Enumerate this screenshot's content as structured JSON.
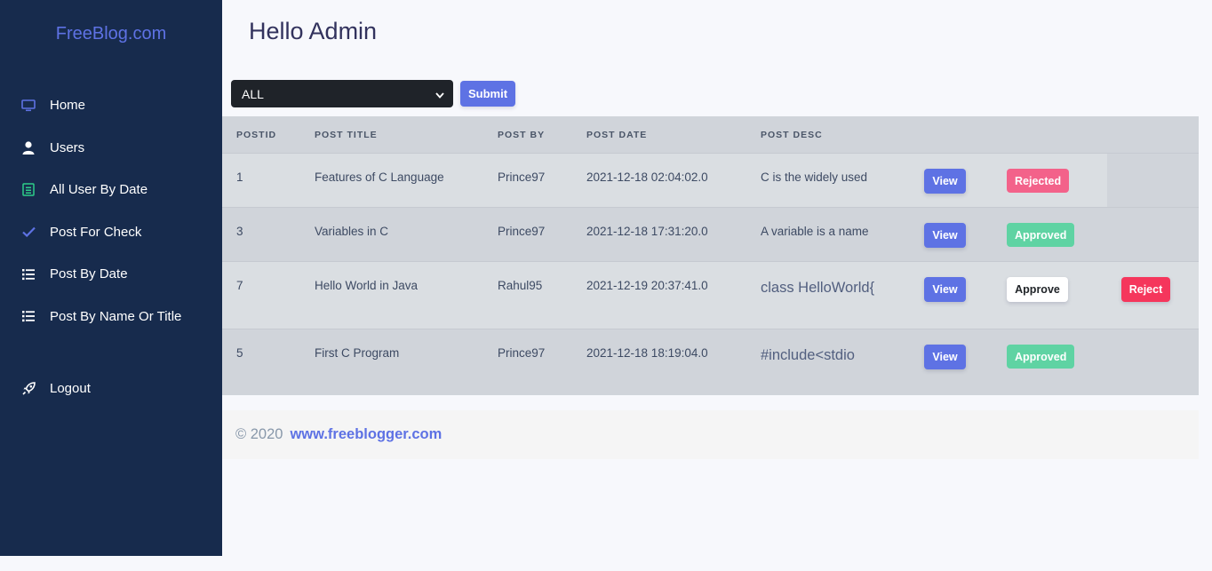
{
  "sidebar": {
    "brand": "FreeBlog.com",
    "items": [
      {
        "label": "Home",
        "icon": "monitor-icon"
      },
      {
        "label": "Users",
        "icon": "user-icon"
      },
      {
        "label": "All User By Date",
        "icon": "calendar-list-icon"
      },
      {
        "label": "Post For Check",
        "icon": "check-icon"
      },
      {
        "label": "Post By Date",
        "icon": "list-icon"
      },
      {
        "label": "Post By Name Or Title",
        "icon": "list-icon"
      }
    ],
    "logout": {
      "label": "Logout",
      "icon": "rocket-icon"
    }
  },
  "header": {
    "title": "Hello Admin"
  },
  "filter": {
    "selected": "ALL",
    "submit_label": "Submit"
  },
  "table": {
    "columns": [
      "POSTID",
      "POST TITLE",
      "POST BY",
      "POST DATE",
      "POST DESC"
    ],
    "rows": [
      {
        "id": "1",
        "title": "Features of C Language",
        "by": "Prince97",
        "date": "2021-12-18 02:04:02.0",
        "desc": "C is the widely used",
        "view": "View",
        "status": "Rejected"
      },
      {
        "id": "3",
        "title": "Variables in C",
        "by": "Prince97",
        "date": "2021-12-18 17:31:20.0",
        "desc": "A variable is a name",
        "view": "View",
        "status": "Approved"
      },
      {
        "id": "7",
        "title": "Hello World in Java",
        "by": "Rahul95",
        "date": "2021-12-19 20:37:41.0",
        "desc": "class HelloWorld{",
        "view": "View",
        "approve": "Approve",
        "reject": "Reject"
      },
      {
        "id": "5",
        "title": "First C Program",
        "by": "Prince97",
        "date": "2021-12-18 18:19:04.0",
        "desc": "#include<stdio",
        "view": "View",
        "status": "Approved"
      }
    ]
  },
  "footer": {
    "copyright": "© 2020",
    "link": "www.freeblogger.com"
  },
  "colors": {
    "sidebar": "#172b4d",
    "primary": "#5e72e4",
    "success": "#5fd3a3",
    "danger": "#f5365c",
    "rejected": "#f3628a"
  }
}
